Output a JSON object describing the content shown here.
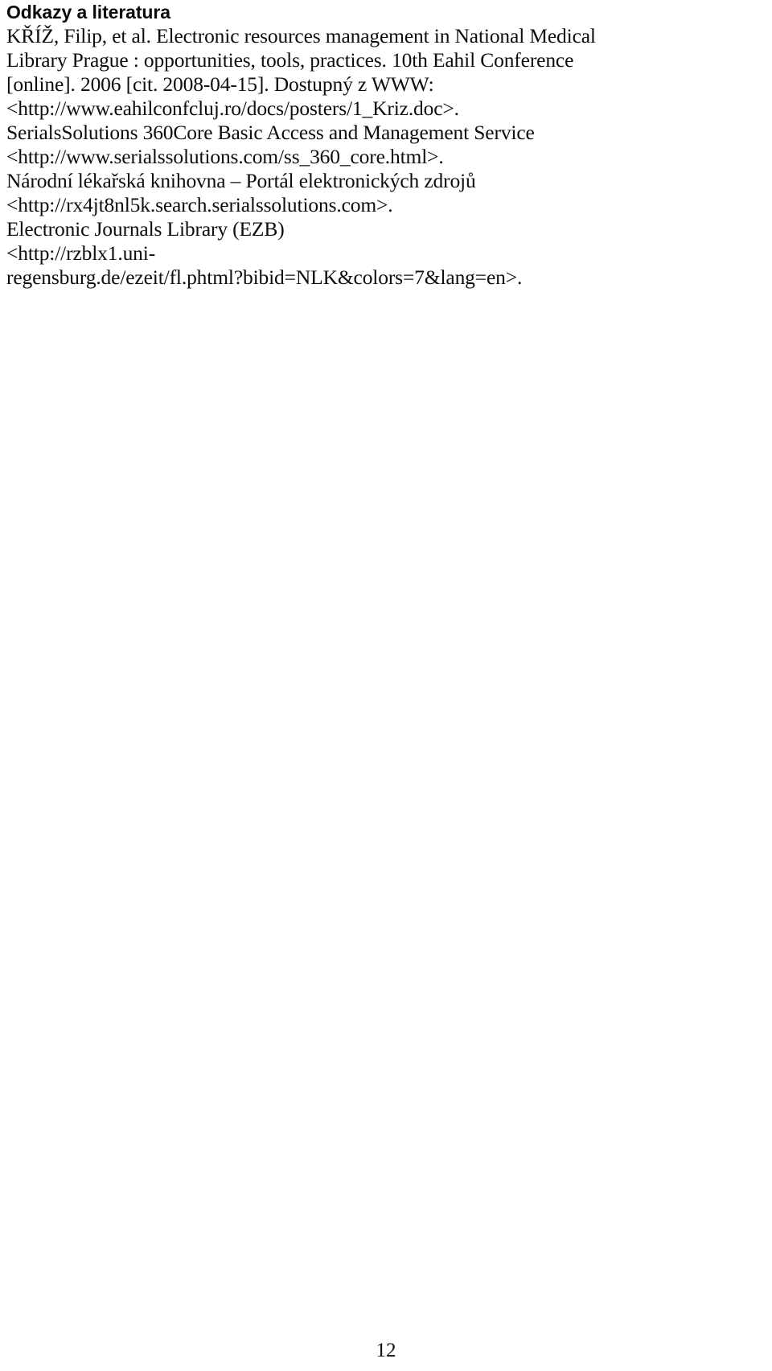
{
  "document": {
    "page_number": "12",
    "language": "cs",
    "background_color": "#ffffff",
    "text_color": "#0d0d0d"
  },
  "references_section": {
    "heading": "Odkazy a literatura",
    "lines": [
      {
        "id": "line-1",
        "text": "KŘÍŽ, Filip, et al. Electronic resources management in National Medical"
      },
      {
        "id": "line-2",
        "text": "Library Prague : opportunities, tools, practices. 10th Eahil Conference"
      },
      {
        "id": "line-3",
        "text": "[online]. 2006 [cit. 2008-04-15]. Dostupný z WWW:"
      },
      {
        "id": "line-4",
        "text": "<http://www.eahilconfcluj.ro/docs/posters/1_Kriz.doc>."
      },
      {
        "id": "line-5",
        "text": "SerialsSolutions 360Core Basic Access and Management Service"
      },
      {
        "id": "line-6",
        "text": "<http://www.serialssolutions.com/ss_360_core.html>."
      },
      {
        "id": "line-7",
        "text": "Národní lékařská knihovna – Portál elektronických zdrojů"
      },
      {
        "id": "line-8",
        "text": "<http://rx4jt8nl5k.search.serialssolutions.com>."
      },
      {
        "id": "line-9",
        "text": "Electronic Journals Library (EZB)"
      },
      {
        "id": "line-10",
        "text": "<http://rzblx1.uni-"
      },
      {
        "id": "line-11",
        "text": "regensburg.de/ezeit/fl.phtml?bibid=NLK&colors=7&lang=en>."
      }
    ]
  }
}
